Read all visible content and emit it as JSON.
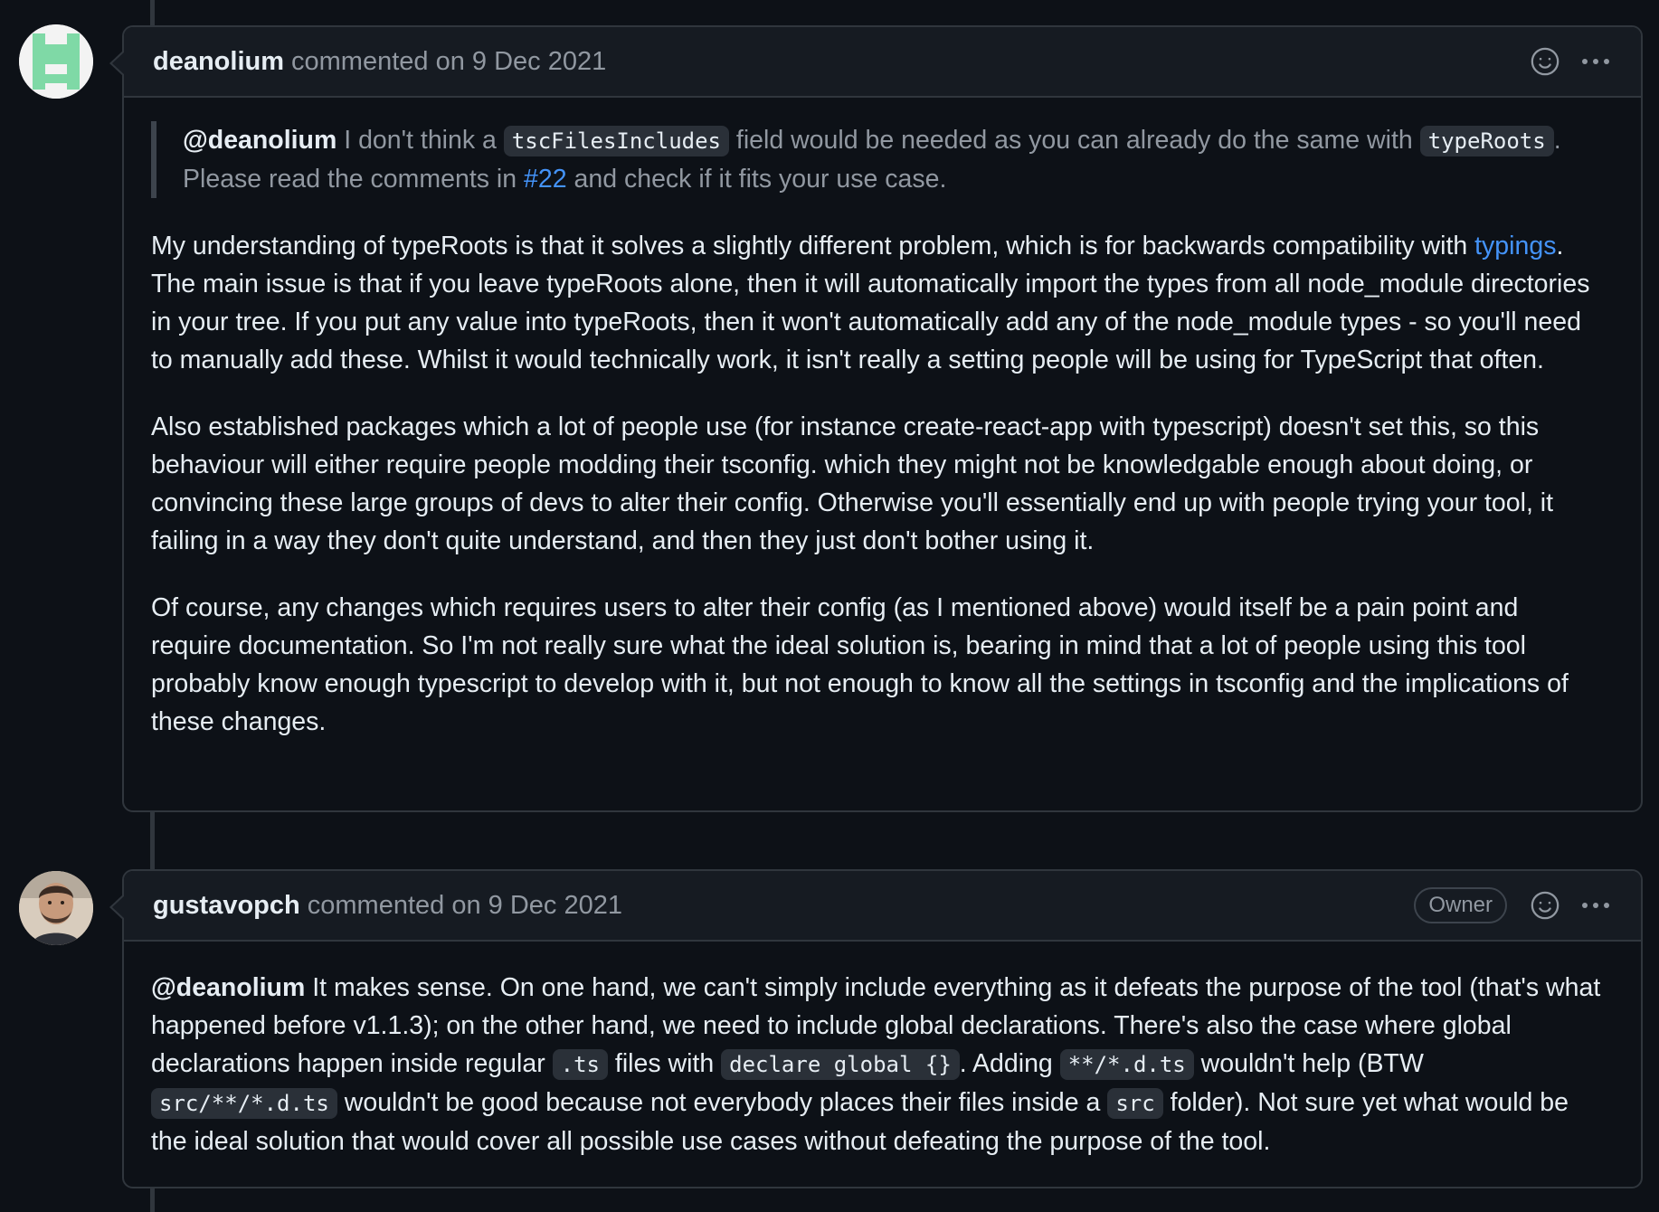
{
  "comments": [
    {
      "author": "deanolium",
      "meta": "commented on 9 Dec 2021",
      "quote": {
        "mention": "@deanolium",
        "t1": " I don't think a ",
        "code1": "tscFilesIncludes",
        "t2": " field would be needed as you can already do the same with ",
        "code2": "typeRoots",
        "t3": ". Please read the comments in ",
        "link": "#22",
        "t4": " and check if it fits your use case."
      },
      "p1": {
        "t1": "My understanding of typeRoots is that it solves a slightly different problem, which is for backwards compatibility with ",
        "link": "typings",
        "t2": ". The main issue is that if you leave typeRoots alone, then it will automatically import the types from all node_module directories in your tree. If you put any value into typeRoots, then it won't automatically add any of the node_module types - so you'll need to manually add these. Whilst it would technically work, it isn't really a setting people will be using for TypeScript that often."
      },
      "p2": "Also established packages which a lot of people use (for instance create-react-app with typescript) doesn't set this, so this behaviour will either require people modding their tsconfig. which they might not be knowledgable enough about doing, or convincing these large groups of devs to alter their config. Otherwise you'll essentially end up with people trying your tool, it failing in a way they don't quite understand, and then they just don't bother using it.",
      "p3": "Of course, any changes which requires users to alter their config (as I mentioned above) would itself be a pain point and require documentation. So I'm not really sure what the ideal solution is, bearing in mind that a lot of people using this tool probably know enough typescript to develop with it, but not enough to know all the settings in tsconfig and the implications of these changes."
    },
    {
      "author": "gustavopch",
      "meta": "commented on 9 Dec 2021",
      "badge": "Owner",
      "body": {
        "mention": "@deanolium",
        "t1": " It makes sense. On one hand, we can't simply include everything as it defeats the purpose of the tool (that's what happened before v1.1.3); on the other hand, we need to include global declarations. There's also the case where global declarations happen inside regular ",
        "code1": ".ts",
        "t2": " files with ",
        "code2": "declare global {}",
        "t3": ". Adding ",
        "code3": "**/*.d.ts",
        "t4": " wouldn't help (BTW ",
        "code4": "src/**/*.d.ts",
        "t5": " wouldn't be good because not everybody places their files inside a ",
        "code5": "src",
        "t6": " folder). Not sure yet what would be the ideal solution that would cover all possible use cases without defeating the purpose of the tool."
      }
    }
  ],
  "icons": {
    "reaction": "smiley-icon",
    "more": "kebab-horizontal-icon"
  }
}
